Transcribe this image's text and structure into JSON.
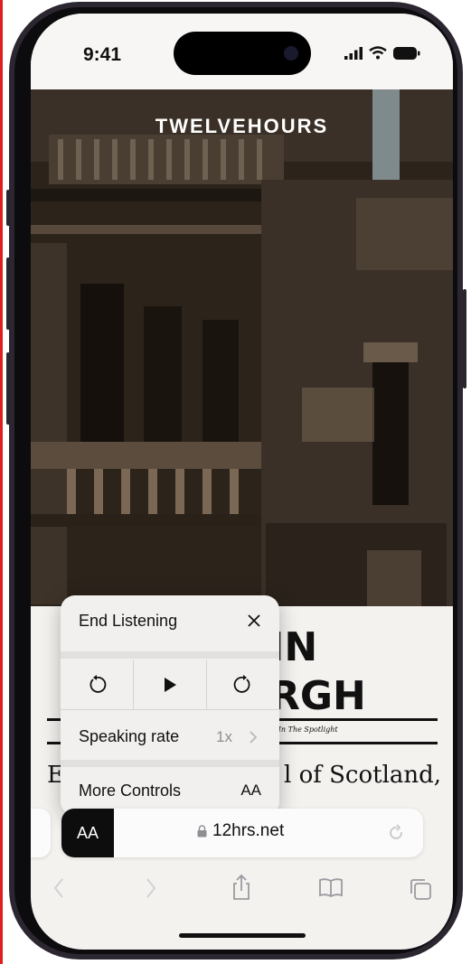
{
  "status_bar": {
    "time": "9:41"
  },
  "hero": {
    "brand": "TWELVEHOURS"
  },
  "article": {
    "headline_line1": "IN",
    "headline_line2": "RGH",
    "tagline": "ce In The Spotlight",
    "body_fragment_left": "E",
    "body_fragment_right": "l of Scotland,"
  },
  "listen_menu": {
    "end_label": "End Listening",
    "close_icon": "close-icon",
    "controls": [
      "skip-back-icon",
      "play-icon",
      "skip-forward-icon"
    ],
    "speaking_rate_label": "Speaking rate",
    "speaking_rate_value": "1x",
    "more_controls_label": "More Controls",
    "text_size_label": "AA"
  },
  "address_bar": {
    "aa_label": "AA",
    "url": "12hrs.net"
  },
  "toolbar": {
    "items": [
      "back-icon",
      "forward-icon",
      "share-icon",
      "bookmarks-icon",
      "tabs-icon"
    ]
  }
}
